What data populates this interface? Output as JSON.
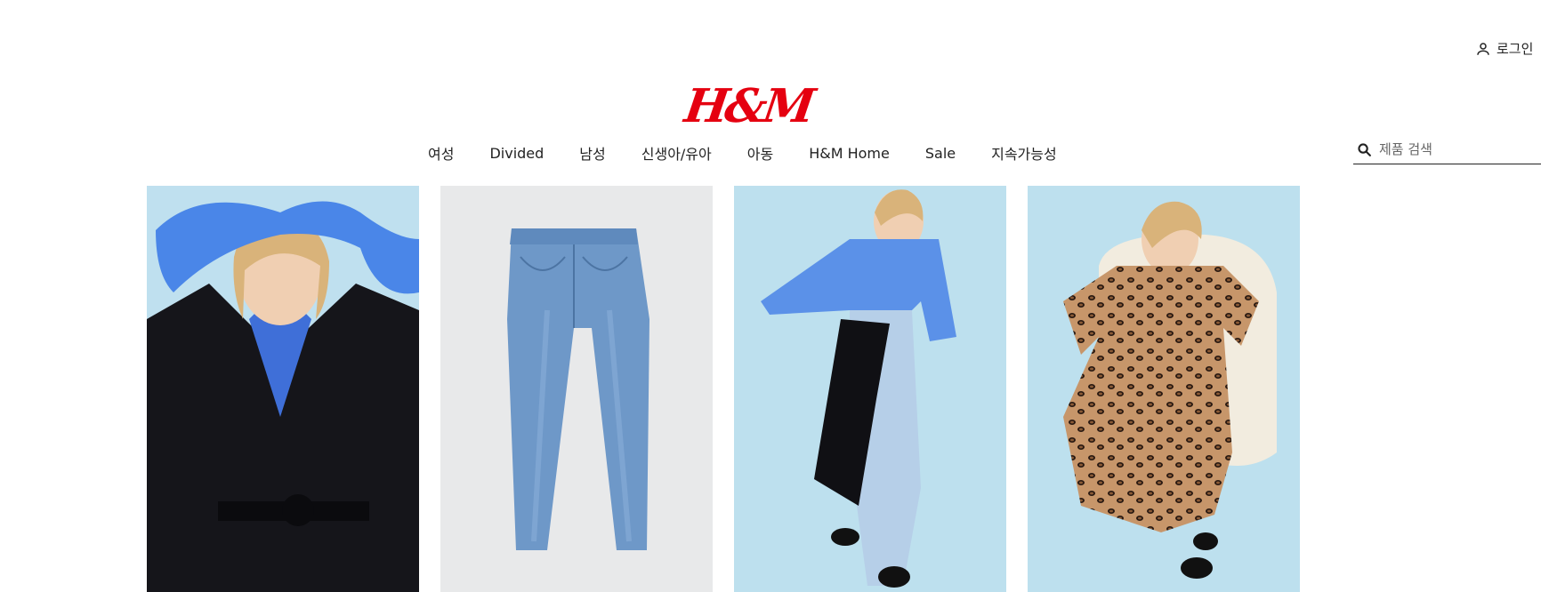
{
  "header": {
    "login_label": "로그인",
    "logo_text": "H&M",
    "brand_color": "#e50010"
  },
  "nav": {
    "items": [
      "여성",
      "Divided",
      "남성",
      "신생아/유아",
      "아동",
      "H&M Home",
      "Sale",
      "지속가능성"
    ]
  },
  "search": {
    "placeholder": "제품 검색",
    "value": ""
  },
  "products": [
    {
      "description": "black coat with blue sweater"
    },
    {
      "description": "blue denim jeans"
    },
    {
      "description": "blue sweater with jeans and coat"
    },
    {
      "description": "leopard print dress on white chair"
    }
  ],
  "icons": {
    "user": "user-icon",
    "search": "search-icon"
  }
}
